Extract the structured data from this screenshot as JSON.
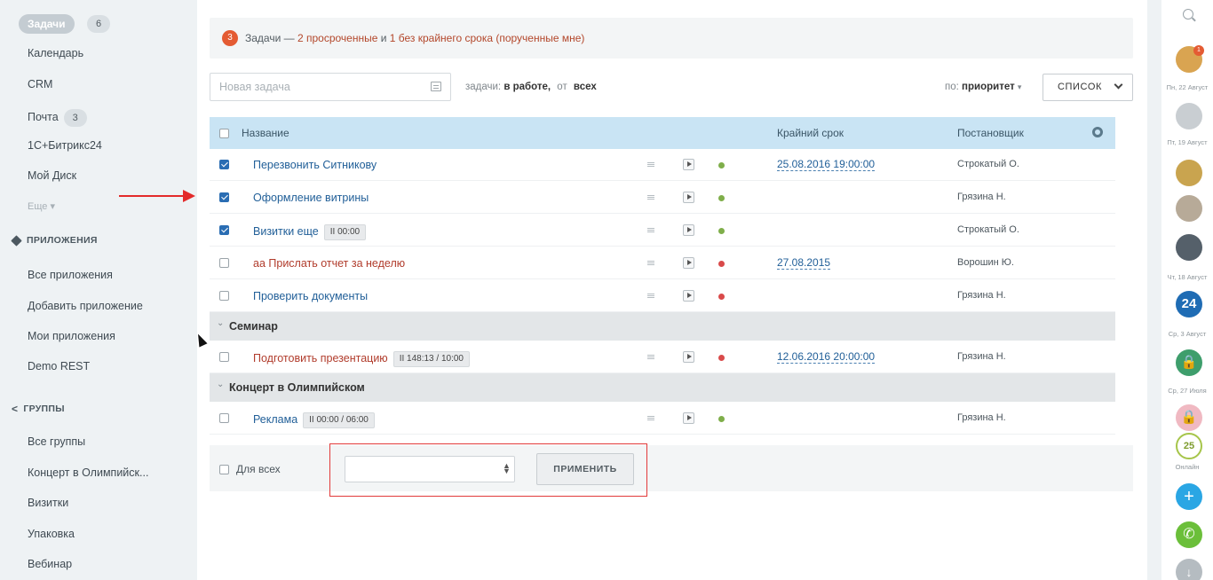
{
  "sidebar": {
    "tasks_label": "Задачи",
    "tasks_count": "6",
    "calendar": "Календарь",
    "crm": "CRM",
    "mail_label": "Почта",
    "mail_count": "3",
    "bitrix": "1С+Битрикс24",
    "disk": "Мой Диск",
    "more": "Еще",
    "apps_section": "ПРИЛОЖЕНИЯ",
    "apps": [
      "Все приложения",
      "Добавить приложение",
      "Мои приложения",
      "Demo REST"
    ],
    "groups_section": "ГРУППЫ",
    "groups": [
      "Все группы",
      "Концерт в Олимпийск...",
      "Визитки",
      "Упаковка",
      "Вебинар"
    ]
  },
  "banner": {
    "count": "3",
    "prefix": "Задачи — ",
    "overdue": "2 просроченные",
    "middle": " и ",
    "nodeadline": "1 без крайнего срока",
    "suffix": " (порученные мне)"
  },
  "toolbar": {
    "new_task_placeholder": "Новая задача",
    "filter_prefix": "задачи:",
    "filter_status": "в работе,",
    "filter_from": "от",
    "filter_who": "всех",
    "sort_prefix": "по:",
    "sort_value": "приоритет",
    "view_label": "СПИСОК"
  },
  "table": {
    "col_name": "Название",
    "col_deadline": "Крайний срок",
    "col_author": "Постановщик",
    "rows": [
      {
        "title": "Перезвонить Ситникову",
        "timer": "",
        "deadline": "25.08.2016 19:00:00",
        "author": "Строкатый О.",
        "checked": true,
        "status": "green",
        "title_color": "blue"
      },
      {
        "title": "Оформление витрины",
        "timer": "",
        "deadline": "",
        "author": "Грязина Н.",
        "checked": true,
        "status": "green",
        "title_color": "blue"
      },
      {
        "title": "Визитки еще",
        "timer": "II 00:00",
        "deadline": "",
        "author": "Строкатый О.",
        "checked": true,
        "status": "green",
        "title_color": "blue"
      },
      {
        "title": "аа Прислать отчет за неделю",
        "timer": "",
        "deadline": "27.08.2015",
        "author": "Ворошин Ю.",
        "checked": false,
        "status": "red",
        "title_color": "red"
      },
      {
        "title": "Проверить документы",
        "timer": "",
        "deadline": "",
        "author": "Грязина Н.",
        "checked": false,
        "status": "red",
        "title_color": "blue"
      }
    ],
    "groups": [
      {
        "name": "Семинар",
        "rows": [
          {
            "title": "Подготовить презентацию",
            "timer": "II 148:13 / 10:00",
            "deadline": "12.06.2016 20:00:00",
            "author": "Грязина Н.",
            "checked": false,
            "status": "red",
            "title_color": "red"
          }
        ]
      },
      {
        "name": "Концерт в Олимпийском",
        "rows": [
          {
            "title": "Реклама",
            "timer": "II 00:00 / 06:00",
            "deadline": "",
            "author": "Грязина Н.",
            "checked": false,
            "status": "green",
            "title_color": "blue"
          }
        ]
      }
    ]
  },
  "actions": {
    "for_all_label": "Для всех",
    "apply_label": "ПРИМЕНИТЬ"
  },
  "rightbar": {
    "dates": [
      "Пн, 22 Август",
      "Пт, 19 Август",
      "Чт, 18 Август",
      "Ср, 3 Август",
      "Ср, 27 Июля"
    ],
    "notif_count": "1",
    "online_count": "25",
    "online_label": "Онлайн",
    "b24_label": "24"
  },
  "colors": {
    "accent": "#215f98",
    "header": "#c9e4f4",
    "overdue": "#b13c2c",
    "annotation": "#e23a3a"
  }
}
